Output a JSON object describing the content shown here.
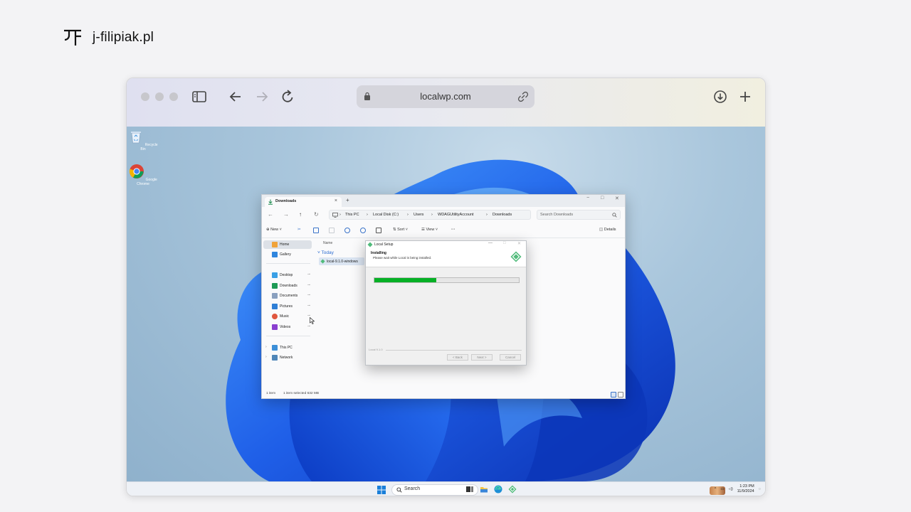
{
  "brand": {
    "name": "j-filipiak.pl"
  },
  "browser": {
    "url": "localwp.com"
  },
  "desktop": {
    "icons": [
      {
        "label": "Recycle Bin",
        "icon": "recycle-bin-icon"
      },
      {
        "label": "Google Chrome",
        "icon": "chrome-icon"
      }
    ]
  },
  "explorer": {
    "tab_label": "Downloads",
    "breadcrumbs": [
      "This PC",
      "Local Disk (C:)",
      "Users",
      "WDAGUtilityAccount",
      "Downloads"
    ],
    "search_placeholder": "Search Downloads",
    "commands": {
      "new": "New",
      "sort": "Sort",
      "view": "View",
      "more": "···",
      "details": "Details"
    },
    "sidebar": {
      "home": "Home",
      "gallery": "Gallery",
      "quick": [
        "Desktop",
        "Downloads",
        "Documents",
        "Pictures",
        "Music",
        "Videos"
      ],
      "this_pc": "This PC",
      "network": "Network"
    },
    "column_name": "Name",
    "group_today": "Today",
    "file_name": "local-9.1.0-windows",
    "status": {
      "count": "1 item",
      "selected": "1 item selected  632 MB"
    }
  },
  "dialog": {
    "title": "Local Setup",
    "heading": "Installing",
    "subtext": "Please wait while Local is being installed.",
    "progress": 0.43,
    "version": "Local 9.1.0",
    "buttons": {
      "back": "< Back",
      "next": "Next >",
      "cancel": "Cancel"
    }
  },
  "taskbar": {
    "search": "Search",
    "time": "1:23 PM",
    "date": "11/9/2024"
  },
  "colors": {
    "progress": "#06b025",
    "accent": "#2a6bd1",
    "local_brand": "#51bb7b"
  }
}
